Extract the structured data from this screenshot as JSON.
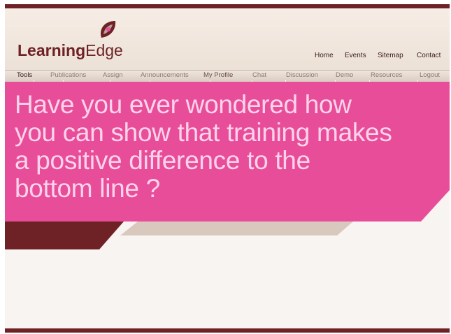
{
  "brand": {
    "name_bold": "Learning",
    "name_regular": "Edge"
  },
  "top_nav": [
    {
      "label": "Home"
    },
    {
      "label": "Events"
    },
    {
      "label": "Sitemap"
    },
    {
      "label": "Contact"
    }
  ],
  "menu": [
    {
      "label": "Tools",
      "active": true
    },
    {
      "label": "Publications",
      "active": false
    },
    {
      "label": "Assign",
      "active": false
    },
    {
      "label": "Announcements",
      "active": false
    },
    {
      "label": "My Profile",
      "active": false
    },
    {
      "label": "Chat",
      "active": false
    },
    {
      "label": "Discussion",
      "active": false
    },
    {
      "label": "Demo",
      "active": false
    },
    {
      "label": "Resources",
      "active": false
    },
    {
      "label": "Logout",
      "active": false
    }
  ],
  "hero": {
    "lines": [
      "Have you ever wondered how",
      "you can show that training makes",
      "a positive difference to the",
      "bottom line ?"
    ]
  },
  "colors": {
    "maroon": "#6e2226",
    "pink": "#e84d9a",
    "taupe": "#d9c8be",
    "cream": "#f8f4f1"
  },
  "icons": {
    "logo": "leaf-swoosh-logo-icon"
  }
}
